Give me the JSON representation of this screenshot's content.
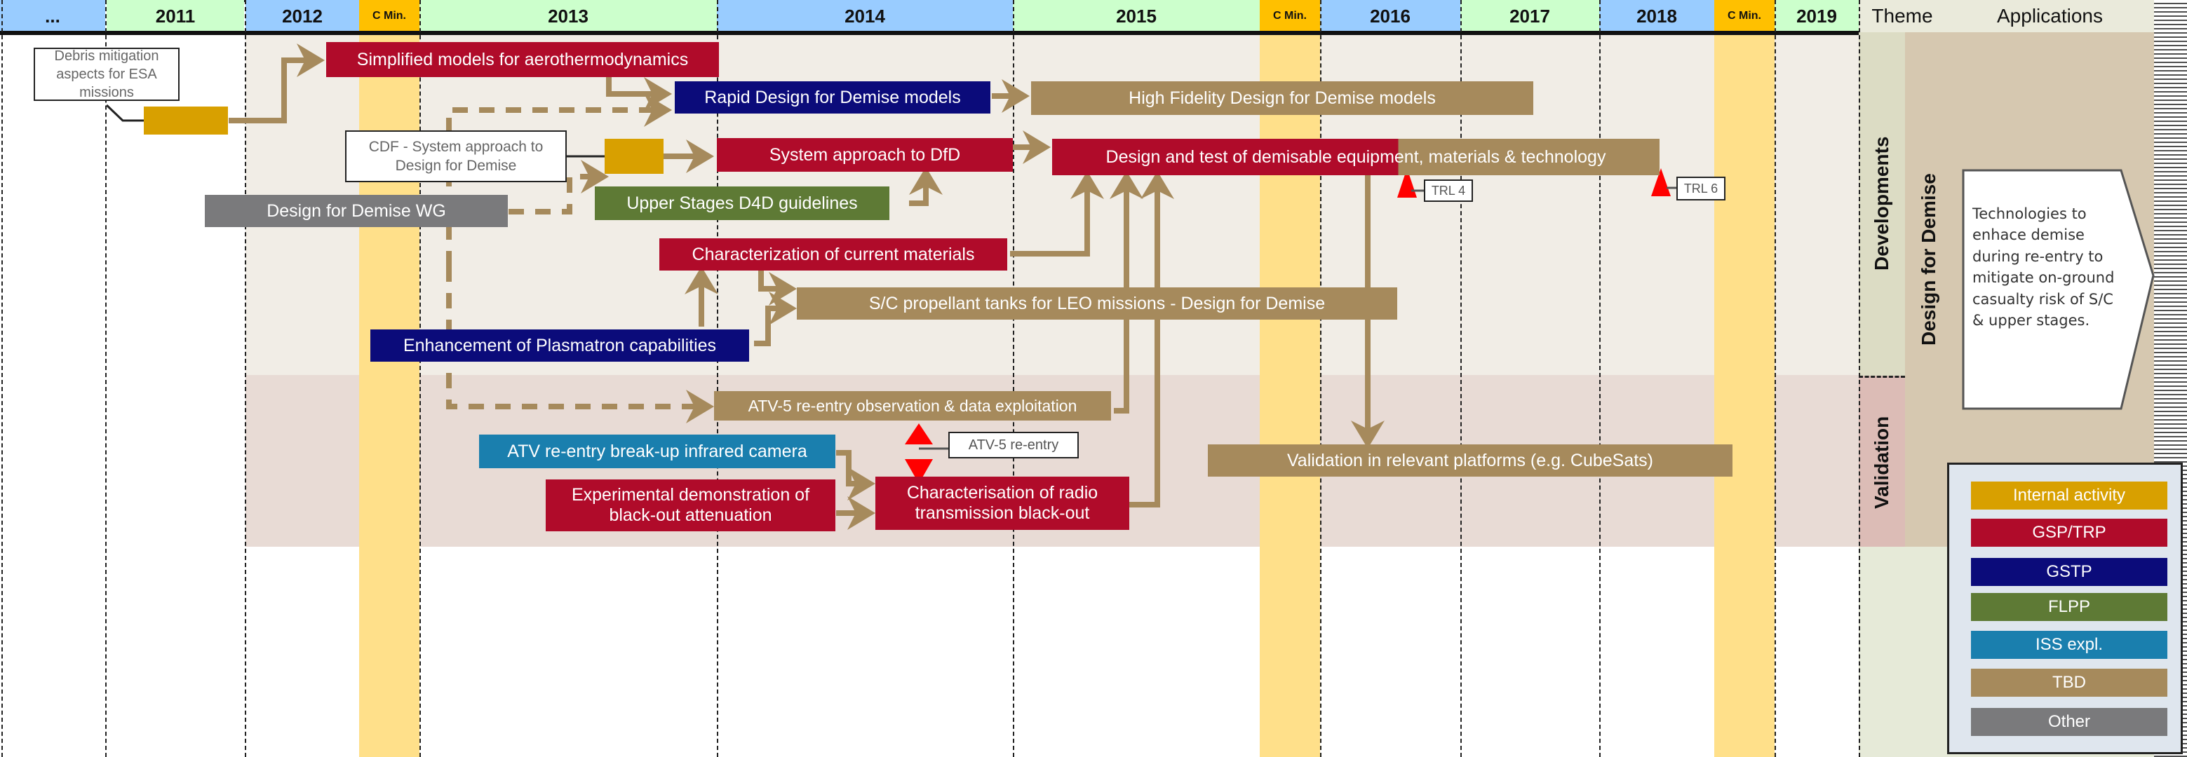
{
  "header": {
    "columns": [
      {
        "label": "...",
        "kind": "blue"
      },
      {
        "label": "2011",
        "kind": "green"
      },
      {
        "label": "2012",
        "kind": "blue"
      },
      {
        "label": "C Min.",
        "kind": "cmin"
      },
      {
        "label": "2013",
        "kind": "green"
      },
      {
        "label": "2014",
        "kind": "blue"
      },
      {
        "label": "2015",
        "kind": "green"
      },
      {
        "label": "C Min.",
        "kind": "cmin"
      },
      {
        "label": "2016",
        "kind": "blue"
      },
      {
        "label": "2017",
        "kind": "green"
      },
      {
        "label": "2018",
        "kind": "blue"
      },
      {
        "label": "C Min.",
        "kind": "cmin"
      },
      {
        "label": "2019",
        "kind": "green"
      }
    ],
    "theme_label": "Theme",
    "applications_label": "Applications"
  },
  "themes": {
    "developments": "Developments",
    "validation": "Validation",
    "design_for_demise": "Design for Demise"
  },
  "application_text": "Technologies to enhace demise during re-entry to mitigate on-ground casualty risk of S/C & upper stages.",
  "notes": {
    "debris": "Debris mitigation aspects for ESA missions",
    "cdf": "CDF - System approach to Design for Demise"
  },
  "activities": {
    "simplified_models": "Simplified models for aerothermodynamics",
    "rapid_d4d": "Rapid Design for Demise models",
    "hifi_d4d": "High Fidelity Design for Demise models",
    "system_dfd": "System approach to DfD",
    "design_test": "Design and test of demisable equipment, materials & technology",
    "upper_stages": "Upper Stages D4D guidelines",
    "d4d_wg": "Design for Demise WG",
    "char_materials": "Characterization of current materials",
    "propellant_tanks": "S/C propellant tanks for LEO missions - Design for Demise",
    "plasmatron": "Enhancement of Plasmatron capabilities",
    "atv5_obs": "ATV-5 re-entry observation & data exploitation",
    "atv_camera": "ATV re-entry break-up infrared camera",
    "exp_demo": "Experimental demonstration of black-out attenuation",
    "char_radio": "Characterisation of radio transmission black-out",
    "validation_platforms": "Validation in relevant platforms (e.g. CubeSats)"
  },
  "milestones": {
    "trl4": "TRL 4",
    "trl6": "TRL 6",
    "atv5_reentry": "ATV-5 re-entry"
  },
  "legend": [
    {
      "label": "Internal activity",
      "color": "#d8a000"
    },
    {
      "label": "GSP/TRP",
      "color": "#b00b2a"
    },
    {
      "label": "GSTP",
      "color": "#0b0b7a"
    },
    {
      "label": "FLPP",
      "color": "#5e7a35"
    },
    {
      "label": "ISS expl.",
      "color": "#1a7fae"
    },
    {
      "label": "TBD",
      "color": "#a68a5c"
    },
    {
      "label": "Other",
      "color": "#7a7a7c"
    }
  ]
}
